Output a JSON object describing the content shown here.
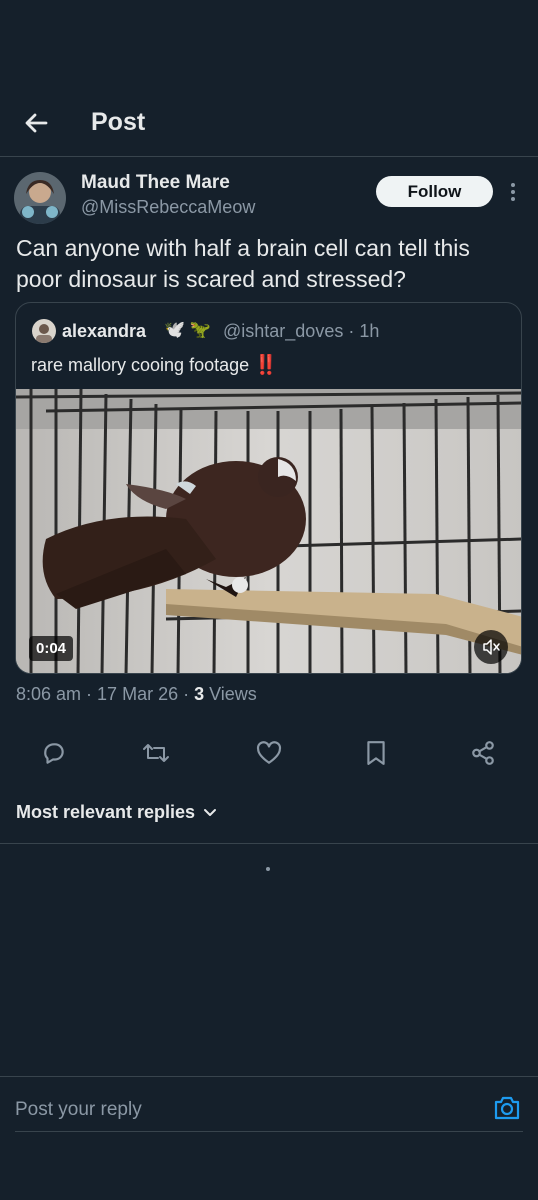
{
  "header": {
    "title": "Post"
  },
  "post": {
    "author_name": "Maud Thee Mare",
    "author_handle": "@MissRebeccaMeow",
    "follow_label": "Follow",
    "text": "Can anyone with half a brain cell can tell this poor dinosaur is scared and stressed?",
    "meta": {
      "time": "8:06 am",
      "sep1": " · ",
      "date": "17 Mar 26",
      "sep2": " · ",
      "views_count": "3",
      "views_label": " Views"
    }
  },
  "quote": {
    "name": "alexandra",
    "emojis": "🕊️ 🦖",
    "handle": "@ishtar_doves",
    "time": "· 1h",
    "text": "rare mallory cooing footage",
    "exclaim": "‼️",
    "video": {
      "duration": "0:04",
      "muted": true
    }
  },
  "actions": [
    {
      "name": "reply-icon"
    },
    {
      "name": "repost-icon"
    },
    {
      "name": "like-icon"
    },
    {
      "name": "bookmark-icon"
    },
    {
      "name": "share-icon"
    }
  ],
  "replies": {
    "sort_label": "Most relevant replies"
  },
  "reply_box": {
    "placeholder": "Post your reply"
  },
  "colors": {
    "background": "#15202b",
    "accent": "#1d9bf0",
    "muted": "#8b98a5",
    "divider": "#38444d"
  }
}
